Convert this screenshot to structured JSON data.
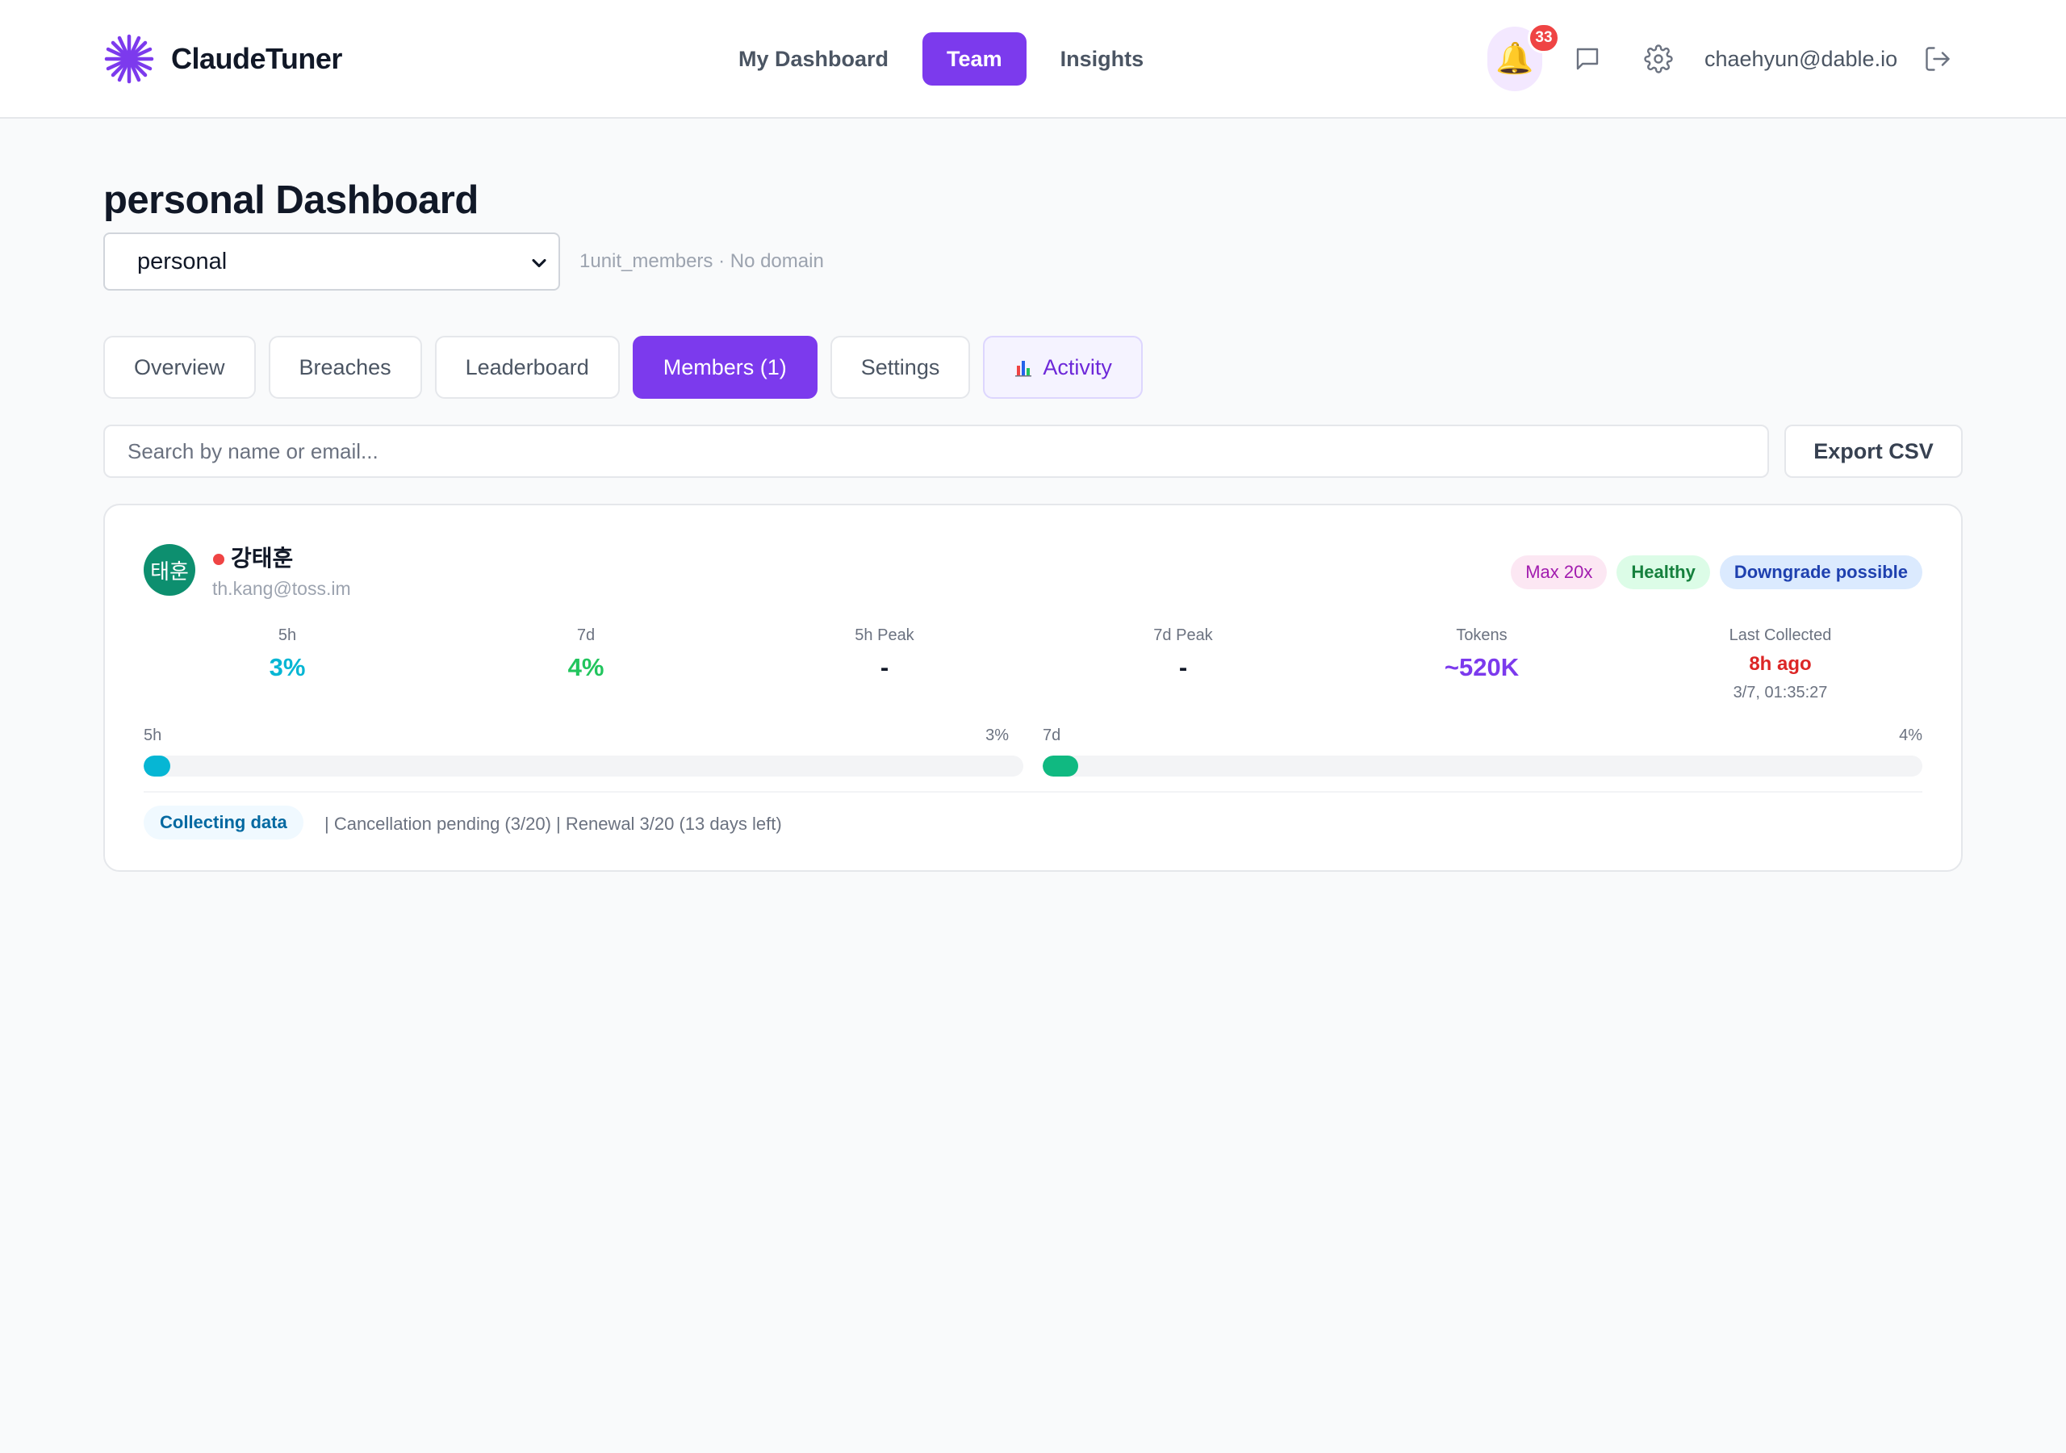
{
  "header": {
    "brand": "ClaudeTuner",
    "nav": [
      {
        "label": "My Dashboard",
        "active": false
      },
      {
        "label": "Team",
        "active": true
      },
      {
        "label": "Insights",
        "active": false
      }
    ],
    "notification_count": "33",
    "user_email": "chaehyun@dable.io"
  },
  "page": {
    "title": "personal Dashboard",
    "team_select": "personal",
    "team_meta": "1unit_members · No domain"
  },
  "tabs": [
    {
      "label": "Overview"
    },
    {
      "label": "Breaches"
    },
    {
      "label": "Leaderboard"
    },
    {
      "label": "Members (1)"
    },
    {
      "label": "Settings"
    },
    {
      "label": "Activity"
    }
  ],
  "search": {
    "placeholder": "Search by name or email..."
  },
  "export_label": "Export CSV",
  "member": {
    "avatar_text": "태훈",
    "name": "강태훈",
    "email": "th.kang@toss.im",
    "badges": {
      "plan": "Max 20x",
      "health": "Healthy",
      "recommendation": "Downgrade possible"
    },
    "stats": {
      "usage_5h": {
        "label": "5h",
        "value": "3%"
      },
      "usage_7d": {
        "label": "7d",
        "value": "4%"
      },
      "peak_5h": {
        "label": "5h Peak",
        "value": "-"
      },
      "peak_7d": {
        "label": "7d Peak",
        "value": "-"
      },
      "tokens": {
        "label": "Tokens",
        "value": "~520K"
      },
      "last_collected": {
        "label": "Last Collected",
        "value": "8h ago",
        "time": "3/7, 01:35:27"
      }
    },
    "bars": {
      "b5h": {
        "label": "5h",
        "value_text": "3%",
        "fraction": 0.03
      },
      "b7d": {
        "label": "7d",
        "value_text": "4%",
        "fraction": 0.04
      }
    },
    "collect_status": "Collecting data",
    "footer_note": "| Cancellation pending (3/20) | Renewal 3/20 (13 days left)"
  },
  "colors": {
    "accent": "#7c3aed",
    "bar_5h": "#06b6d4",
    "bar_7d": "#10b981",
    "avatar": "#0d8f6f",
    "status_dot": "#ef4444"
  },
  "icons": {
    "logo": "asterisk-logo-icon",
    "bell": "bell-icon",
    "chat": "chat-bubble-icon",
    "settings": "gear-icon",
    "logout": "logout-icon",
    "activity": "bar-chart-icon"
  }
}
